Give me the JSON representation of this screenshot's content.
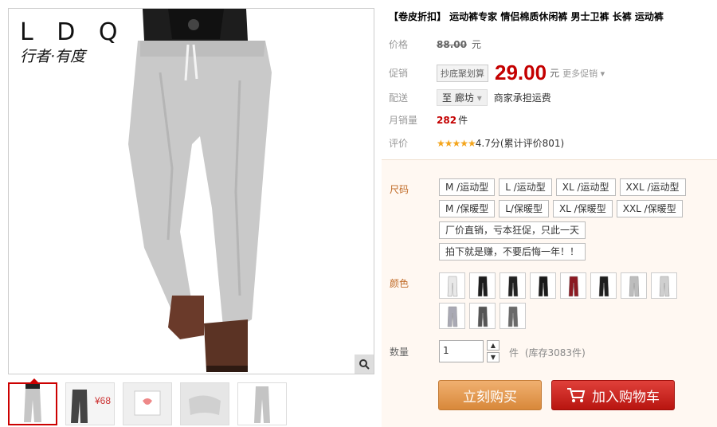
{
  "brand": {
    "name": "L D Q",
    "slogan": "行者·有度"
  },
  "gallery": {
    "zoom_icon": "magnifier-icon",
    "thumbnail_count": 5
  },
  "product": {
    "title": "【卷皮折扣】 运动裤专家 情侣棉质休闲裤 男士卫裤 长裤 运动裤"
  },
  "price_row": {
    "label": "价格",
    "original": "88.00",
    "unit": "元"
  },
  "promo_row": {
    "label": "促销",
    "tag": "抄底聚划算",
    "price": "29.00",
    "unit": "元",
    "more": "更多促销"
  },
  "ship_row": {
    "label": "配送",
    "to_prefix": "至",
    "destination": "廊坊",
    "note": "商家承担运费"
  },
  "sales_row": {
    "label": "月销量",
    "count": "282",
    "unit": "件"
  },
  "rating_row": {
    "label": "评价",
    "stars": "★★★★★",
    "score_text": "4.7分(累计评价801)"
  },
  "size": {
    "label": "尺码",
    "options": [
      "M /运动型",
      "L /运动型",
      "XL /运动型",
      "XXL /运动型",
      "M /保暖型",
      "L/保暖型",
      "XL /保暖型",
      "XXL /保暖型",
      "厂价直销，亏本狂促，只此一天",
      "拍下就是赚，不要后悔一年！！"
    ]
  },
  "color": {
    "label": "颜色",
    "swatch_colors": [
      "#e8e8e8",
      "#1c1c1c",
      "#222222",
      "#1a1a1a",
      "#8b1a22",
      "#1e1e1e",
      "#bdbdbd",
      "#cfcfcf",
      "#a9a9b4",
      "#555555",
      "#6a6a6a"
    ]
  },
  "quantity": {
    "label": "数量",
    "value": "1",
    "unit": "件",
    "stock": "(库存3083件)"
  },
  "actions": {
    "buy": "立刻购买",
    "cart": "加入购物车"
  },
  "colors": {
    "price": "#c40000",
    "buy_btn": "#e0944a",
    "cart_btn": "#c8201a"
  }
}
